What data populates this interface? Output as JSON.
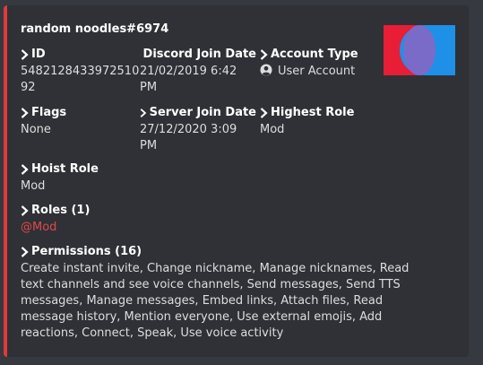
{
  "embed": {
    "author": "random noodles#6974",
    "accent_color": "#e03a3a",
    "thumbnail": "discord-red-blue-logo"
  },
  "fields": {
    "id": {
      "name": "ID",
      "value_lines": [
        "5482128433972510",
        "92"
      ]
    },
    "discord_join": {
      "name": "Discord Join Date",
      "value_lines": [
        "21/02/2019 6:42",
        "PM"
      ]
    },
    "account_type": {
      "name": "Account Type",
      "value": "User Account",
      "icon": "user-circle-icon"
    },
    "flags": {
      "name": "Flags",
      "value": "None"
    },
    "server_join": {
      "name": "Server Join Date",
      "value_lines": [
        "27/12/2020 3:09",
        "PM"
      ]
    },
    "highest_role": {
      "name": "Highest Role",
      "value": "Mod"
    },
    "hoist_role": {
      "name": "Hoist Role",
      "value": "Mod"
    },
    "roles": {
      "name": "Roles (1)",
      "value": "@Mod"
    },
    "permissions": {
      "name": "Permissions (16)",
      "value_lines": [
        "Create instant invite, Change nickname, Manage nicknames, Read",
        "text channels and see voice channels, Send messages, Send TTS",
        "messages, Manage messages, Embed links, Attach files, Read",
        "message history, Mention everyone, Use external emojis, Add",
        "reactions, Connect, Speak, Use voice activity"
      ]
    }
  }
}
